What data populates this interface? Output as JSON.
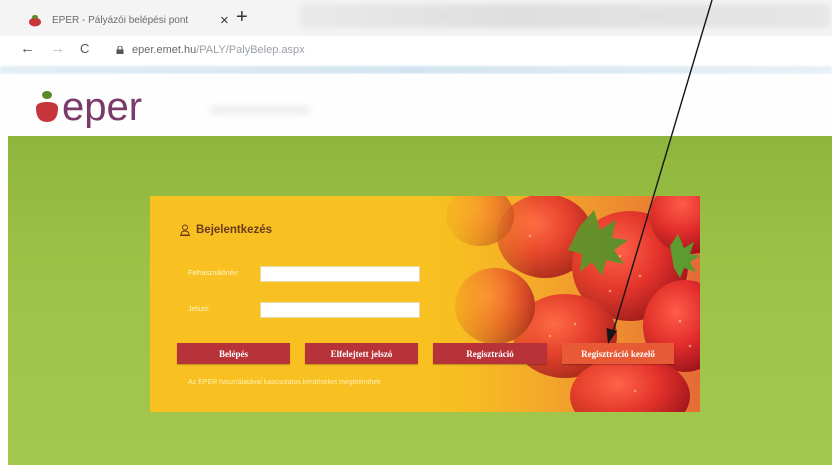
{
  "browser": {
    "tab_title": "EPER - Pályázói belépési pont",
    "tab_close": "×",
    "new_tab": "+",
    "back": "←",
    "forward": "→",
    "reload": "C",
    "url_host": "eper.emet.hu",
    "url_path": "/PALY/PalyBelep.aspx"
  },
  "site": {
    "logo_text": "eper"
  },
  "login": {
    "title": "Bejelentkezés",
    "username_label": "Felhasználónév:",
    "password_label": "Jelszó:",
    "username_value": "",
    "password_value": "",
    "buttons": {
      "login": "Belépés",
      "forgot": "Elfelejtett jelszó",
      "register": "Regisztráció",
      "register_guide": "Regisztráció kezelő"
    },
    "hint": "Az EPER használatával kapcsolatos kérdéseket megtekintheti"
  },
  "colors": {
    "green": "#9cc247",
    "button_red": "#b8323a",
    "button_accent": "#e85a35",
    "logo_purple": "#7a3a6a",
    "logo_red": "#c6343c"
  }
}
